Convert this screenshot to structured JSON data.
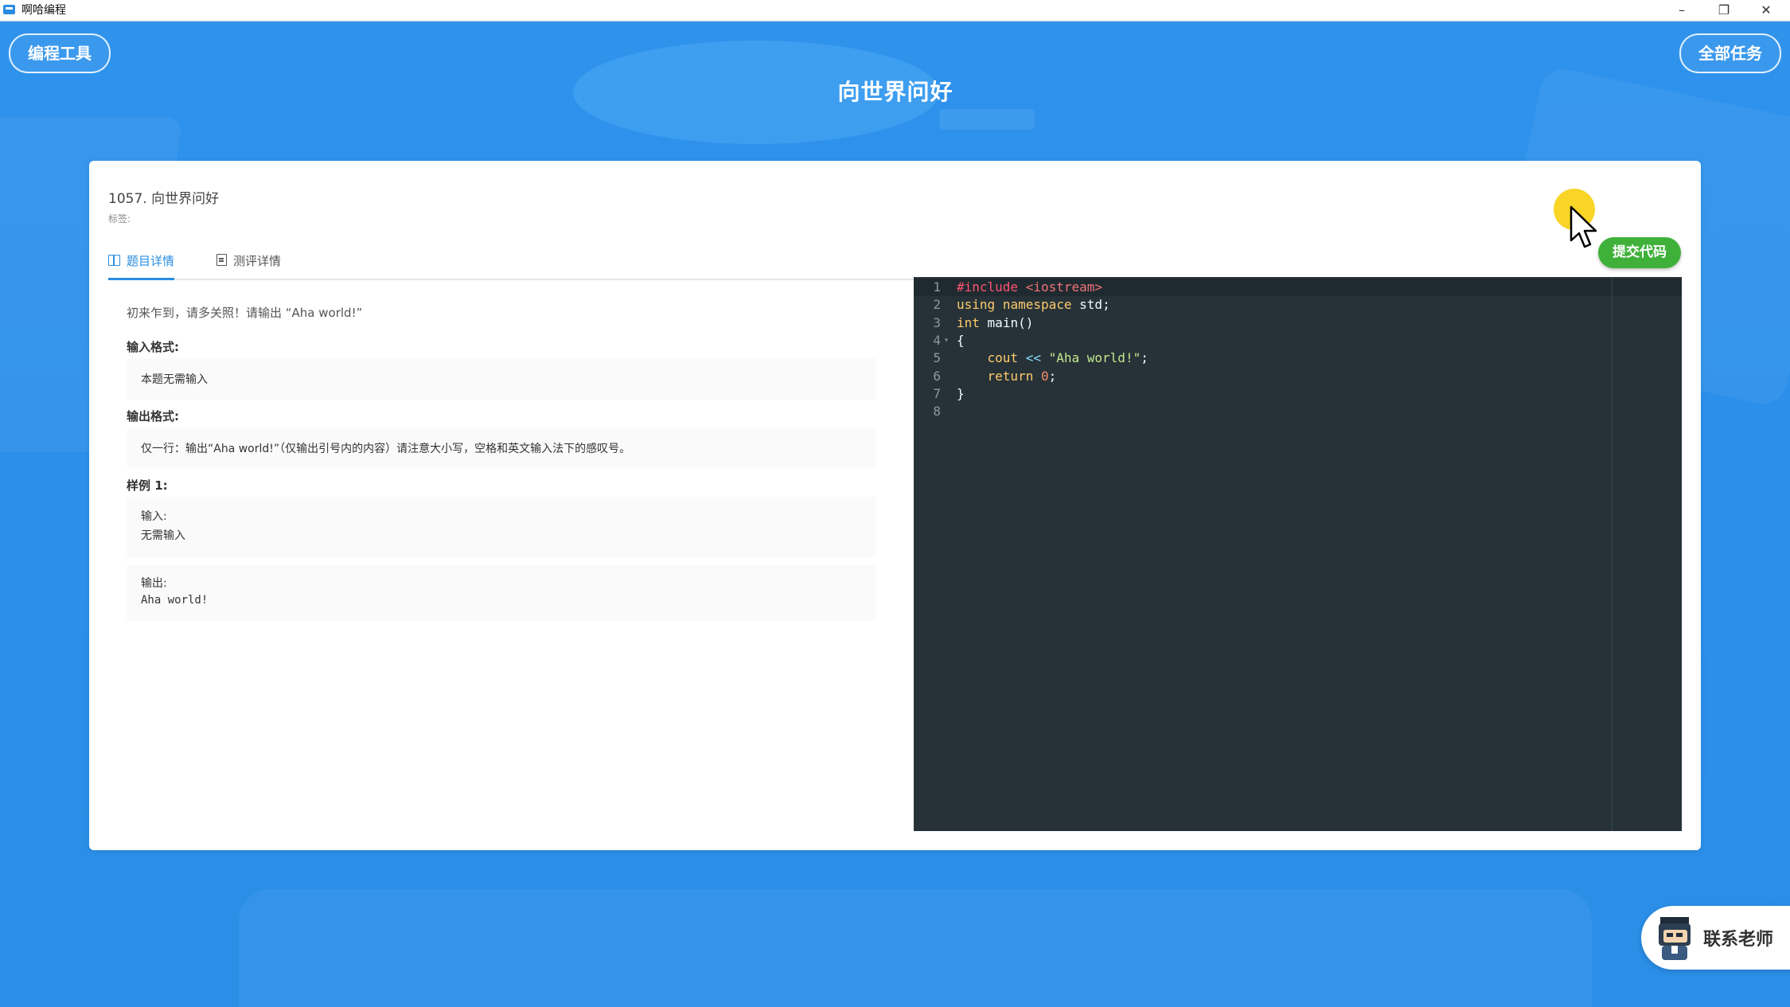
{
  "window": {
    "title": "啊哈编程",
    "minimize_symbol": "–",
    "maximize_symbol": "❐",
    "close_symbol": "✕"
  },
  "header": {
    "tools_button": "编程工具",
    "all_tasks_button": "全部任务",
    "page_title": "向世界问好"
  },
  "problem": {
    "title": "1057. 向世界问好",
    "tags_label": "标签:",
    "tabs": [
      {
        "label": "题目详情",
        "icon": "book-icon",
        "active": true
      },
      {
        "label": "测评详情",
        "icon": "document-icon",
        "active": false
      }
    ],
    "description": "初来乍到，请多关照！请输出 “Aha world!”",
    "input_format_label": "输入格式:",
    "input_format": "本题无需输入",
    "output_format_label": "输出格式:",
    "output_format": "仅一行：输出“Aha world!”（仅输出引号内的内容）请注意大小写，空格和英文输入法下的感叹号。",
    "sample_label": "样例 1:",
    "sample_input_label": "输入:",
    "sample_input": "无需输入",
    "sample_output_label": "输出:",
    "sample_output": "Aha world!"
  },
  "editor": {
    "submit_button": "提交代码",
    "lines": [
      {
        "n": "1",
        "fold": "",
        "code": "#include <iostream>"
      },
      {
        "n": "2",
        "fold": "",
        "code": "using namespace std;"
      },
      {
        "n": "3",
        "fold": "",
        "code": "int main()"
      },
      {
        "n": "4",
        "fold": "▾",
        "code": "{"
      },
      {
        "n": "5",
        "fold": "",
        "code": "    cout << \"Aha world!\";"
      },
      {
        "n": "6",
        "fold": "",
        "code": "    return 0;"
      },
      {
        "n": "7",
        "fold": "",
        "code": "}"
      },
      {
        "n": "8",
        "fold": "",
        "code": ""
      }
    ],
    "theme_colors": {
      "background": "#263238",
      "keyword": "#ffcb6b",
      "preprocessor": "#ff5370",
      "string": "#c3e88d",
      "number": "#f78c6c"
    }
  },
  "contact": {
    "label": "联系老师"
  },
  "colors": {
    "background_blue": "#2e95ea",
    "accent_blue": "#2a8ee0",
    "submit_green": "#3fb13a"
  }
}
